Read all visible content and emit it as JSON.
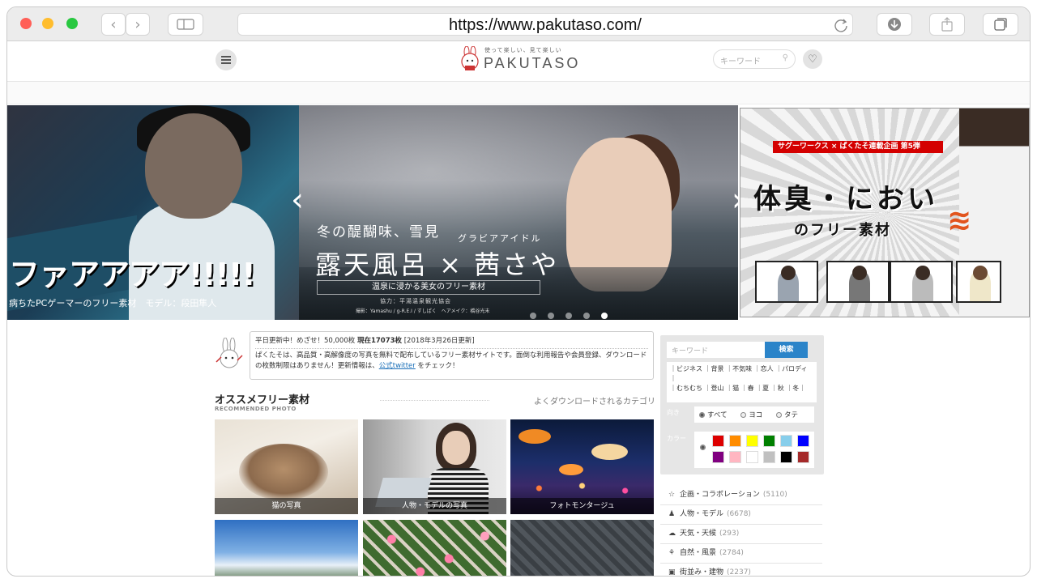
{
  "browser": {
    "url": "https://www.pakutaso.com/",
    "back_icon": "chevron-left",
    "forward_icon": "chevron-right",
    "traffic_lights": [
      "#ff5f57",
      "#ffbd2e",
      "#28c840"
    ]
  },
  "header": {
    "logo_tagline": "使って楽しい、見て楽しい",
    "logo_text": "PAKUTASO",
    "search_placeholder": "キーワード"
  },
  "hero": {
    "left": {
      "big_text": "ファアアアア!!!!!",
      "caption": "病ちたPCゲーマーのフリー素材　モデル：段田隼人"
    },
    "center": {
      "subtitle1": "冬の醍醐味、雪見",
      "subtitle2": "グラビアアイドル",
      "title": "露天風呂 × 茜さや",
      "band": "温泉に浸かる美女のフリー素材",
      "coop": "協力：平湯温泉観光協会",
      "credit": "撮影：Yamashu / g-R.E.I / すしぱく　ヘアメイク：橋谷光未"
    },
    "right": {
      "banner": "サグーワークス × ぱくたそ連載企画 第5弾",
      "title": "体臭・におい",
      "subtitle": "のフリー素材"
    },
    "dots": 5,
    "active_dot": 4
  },
  "intro": {
    "line1_prefix": "平日更新中！めざせ！50,000枚 ",
    "line1_bold": "現在17073枚",
    "line1_suffix": " [2018年3月26日更新]",
    "body_a": "ぱくたそは、高品質・高解像度の写真を無料で配布しているフリー素材サイトです。面倒な利用報告や会員登録、ダウンロードの枚数制限はありません！更新情報は、",
    "link": "公式twitter",
    "body_b": " をチェック！"
  },
  "recommended": {
    "title": "オススメフリー素材",
    "subtitle": "RECOMMENDED PHOTO",
    "link": "よくダウンロードされるカテゴリ",
    "photos": [
      {
        "caption": "猫の写真"
      },
      {
        "caption": "人物・モデルの写真"
      },
      {
        "caption": "フォトモンタージュ"
      }
    ]
  },
  "sidebar": {
    "search_placeholder": "キーワード",
    "search_button": "検索",
    "tags_row1": "｜ビジネス ｜背景 ｜不気味 ｜恋人 ｜パロディ",
    "tags_row1b": "｜",
    "tags_row2": "｜むちむち ｜登山 ｜猫 ｜春 ｜夏 ｜秋 ｜冬｜",
    "orientation_label": "向き",
    "orientation_options": [
      "すべて",
      "ヨコ",
      "タテ"
    ],
    "color_label": "カラー",
    "colors": [
      "#dd0000",
      "#ff8c00",
      "#ffff00",
      "#008000",
      "#87ceeb",
      "#0000ff",
      "#800080",
      "#ffb6c1",
      "#ffffff",
      "#c0c0c0",
      "#000000",
      "#a52a2a"
    ],
    "categories": [
      {
        "icon": "☆",
        "label": "企画・コラボレーション",
        "count": "(5110)"
      },
      {
        "icon": "♟",
        "label": "人物・モデル",
        "count": "(6678)"
      },
      {
        "icon": "☁",
        "label": "天気・天候",
        "count": "(293)"
      },
      {
        "icon": "⚘",
        "label": "自然・風景",
        "count": "(2784)"
      },
      {
        "icon": "▣",
        "label": "街並み・建物",
        "count": "(2237)"
      }
    ]
  }
}
